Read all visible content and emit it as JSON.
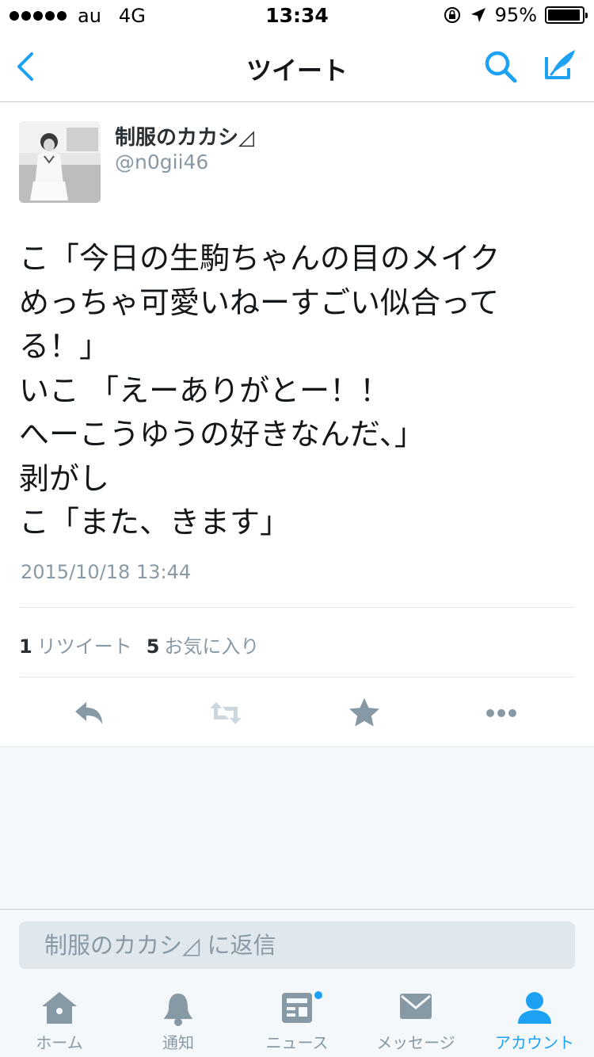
{
  "status_bar": {
    "carrier": "au",
    "network": "4G",
    "time": "13:34",
    "battery_percent": "95%",
    "battery_level": 0.95
  },
  "nav": {
    "title": "ツイート",
    "back_icon": "chevron-left-icon",
    "search_icon": "search-icon",
    "compose_icon": "compose-icon"
  },
  "tweet": {
    "author_name": "制服のカカシ◿",
    "author_handle": "@n0gii46",
    "text": "こ「今日の生駒ちゃんの目のメイク\nめっちゃ可愛いねーすごい似合って\nる！」\nいこ 「えーありがとー！！\nへーこうゆうの好きなんだ、」\n剥がし\nこ「また、きます」",
    "timestamp": "2015/10/18 13:44",
    "retweet_count": "1",
    "retweet_label": "リツイート",
    "like_count": "5",
    "like_label": "お気に入り"
  },
  "actions": [
    {
      "icon": "reply-icon"
    },
    {
      "icon": "retweet-icon"
    },
    {
      "icon": "star-icon"
    },
    {
      "icon": "more-icon"
    }
  ],
  "reply": {
    "placeholder": "制服のカカシ◿ に返信"
  },
  "tab_bar": {
    "tabs": [
      {
        "label": "ホーム",
        "icon": "home-icon"
      },
      {
        "label": "通知",
        "icon": "bell-icon"
      },
      {
        "label": "ニュース",
        "icon": "news-icon"
      },
      {
        "label": "メッセージ",
        "icon": "envelope-icon"
      },
      {
        "label": "アカウント",
        "icon": "person-icon"
      }
    ],
    "active_tab": "アカウント"
  },
  "colors": {
    "accent": "#1da1f2",
    "muted": "#8899a6",
    "action_icon": "#8899a6",
    "background_gray": "#f5f8fa"
  }
}
